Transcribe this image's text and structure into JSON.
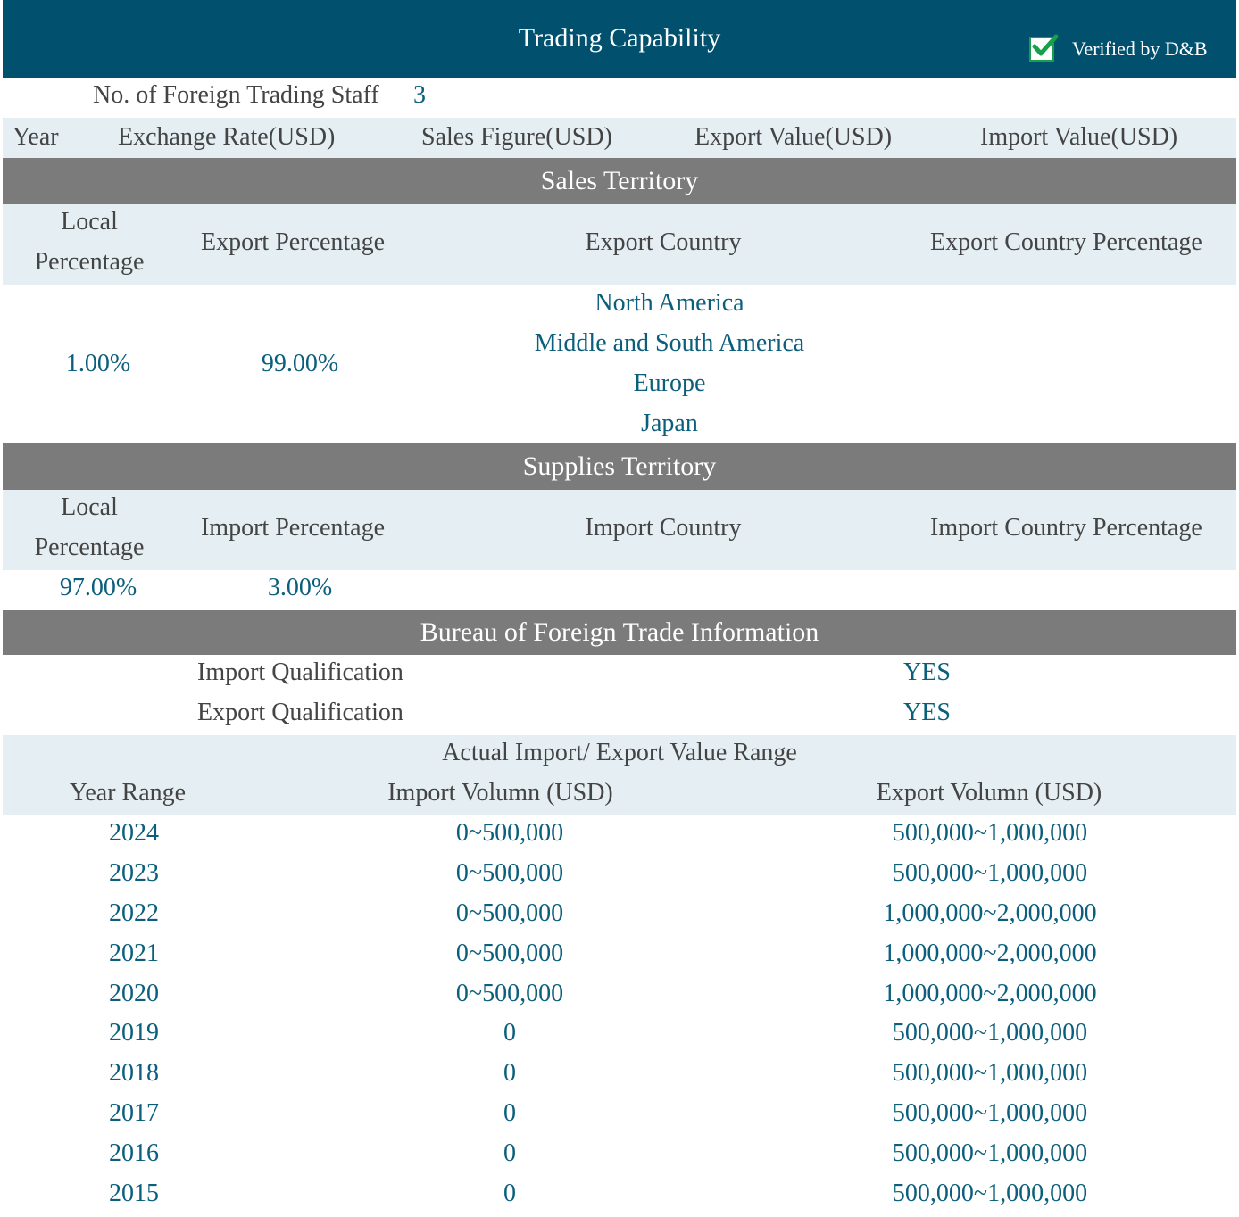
{
  "header": {
    "title": "Trading Capability",
    "verified_label": "Verified by D&B",
    "verified_icon": "checkbox-checked-icon",
    "colors": {
      "header_bg": "#00506e",
      "accent": "#0b5f7c",
      "section_bg": "#7b7b7b",
      "light_band": "#e5eff3",
      "check_green": "#16a04a"
    }
  },
  "staff": {
    "label": "No. of Foreign Trading Staff",
    "value": "3"
  },
  "finance_headers": [
    "Year",
    "Exchange Rate(USD)",
    "Sales Figure(USD)",
    "Export Value(USD)",
    "Import Value(USD)"
  ],
  "sales": {
    "title": "Sales Territory",
    "headers": {
      "local_line1": "Local",
      "local_line2": "Percentage",
      "pct": "Export Percentage",
      "country": "Export Country",
      "country_pct": "Export Country Percentage"
    },
    "local_pct": "1.00%",
    "export_pct": "99.00%",
    "countries": [
      "North America",
      "Middle and South America",
      "Europe",
      "Japan"
    ]
  },
  "supplies": {
    "title": "Supplies Territory",
    "headers": {
      "local_line1": "Local",
      "local_line2": "Percentage",
      "pct": "Import Percentage",
      "country": "Import Country",
      "country_pct": "Import Country Percentage"
    },
    "local_pct": "97.00%",
    "import_pct": "3.00%"
  },
  "bureau": {
    "title": "Bureau of Foreign Trade Information",
    "import_q_label": "Import Qualification",
    "import_q_value": "YES",
    "export_q_label": "Export Qualification",
    "export_q_value": "YES",
    "range_title": "Actual Import/ Export Value Range",
    "col_year": "Year Range",
    "col_import": "Import Volumn (USD)",
    "col_export": "Export Volumn (USD)",
    "rows": [
      {
        "year": "2024",
        "import": "0~500,000",
        "export": "500,000~1,000,000"
      },
      {
        "year": "2023",
        "import": "0~500,000",
        "export": "500,000~1,000,000"
      },
      {
        "year": "2022",
        "import": "0~500,000",
        "export": "1,000,000~2,000,000"
      },
      {
        "year": "2021",
        "import": "0~500,000",
        "export": "1,000,000~2,000,000"
      },
      {
        "year": "2020",
        "import": "0~500,000",
        "export": "1,000,000~2,000,000"
      },
      {
        "year": "2019",
        "import": "0",
        "export": "500,000~1,000,000"
      },
      {
        "year": "2018",
        "import": "0",
        "export": "500,000~1,000,000"
      },
      {
        "year": "2017",
        "import": "0",
        "export": "500,000~1,000,000"
      },
      {
        "year": "2016",
        "import": "0",
        "export": "500,000~1,000,000"
      },
      {
        "year": "2015",
        "import": "0",
        "export": "500,000~1,000,000"
      }
    ]
  }
}
